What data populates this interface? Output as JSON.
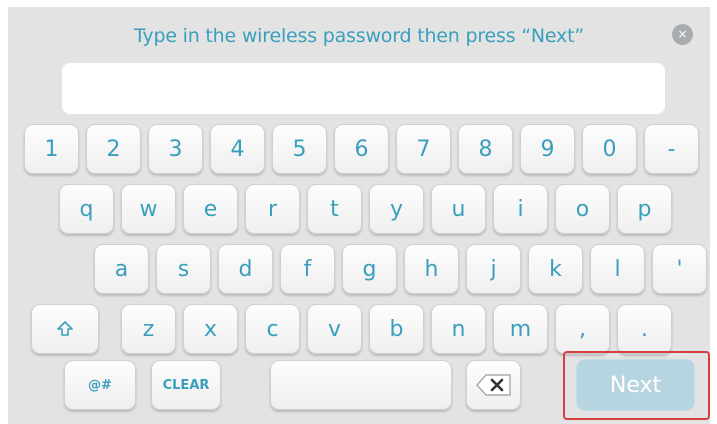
{
  "prompt": "Type in the wireless password then press “Next”",
  "close_label": "×",
  "password_value": "",
  "keys": {
    "row1": [
      "1",
      "2",
      "3",
      "4",
      "5",
      "6",
      "7",
      "8",
      "9",
      "0",
      "-"
    ],
    "row2": [
      "q",
      "w",
      "e",
      "r",
      "t",
      "y",
      "u",
      "i",
      "o",
      "p"
    ],
    "row3": [
      "a",
      "s",
      "d",
      "f",
      "g",
      "h",
      "j",
      "k",
      "l",
      "'"
    ],
    "row4": [
      "z",
      "x",
      "c",
      "v",
      "b",
      "n",
      "m",
      ",",
      "."
    ],
    "shift_icon": "shift-arrow-icon",
    "symbols_label": "@#",
    "clear_label": "CLEAR",
    "space_label": "",
    "backspace_icon": "backspace-icon",
    "next_label": "Next"
  },
  "colors": {
    "accent": "#3a9fbd",
    "background": "#e3e3e3",
    "next_disabled": "#b7d5e1",
    "highlight_outline": "#d5403c"
  }
}
